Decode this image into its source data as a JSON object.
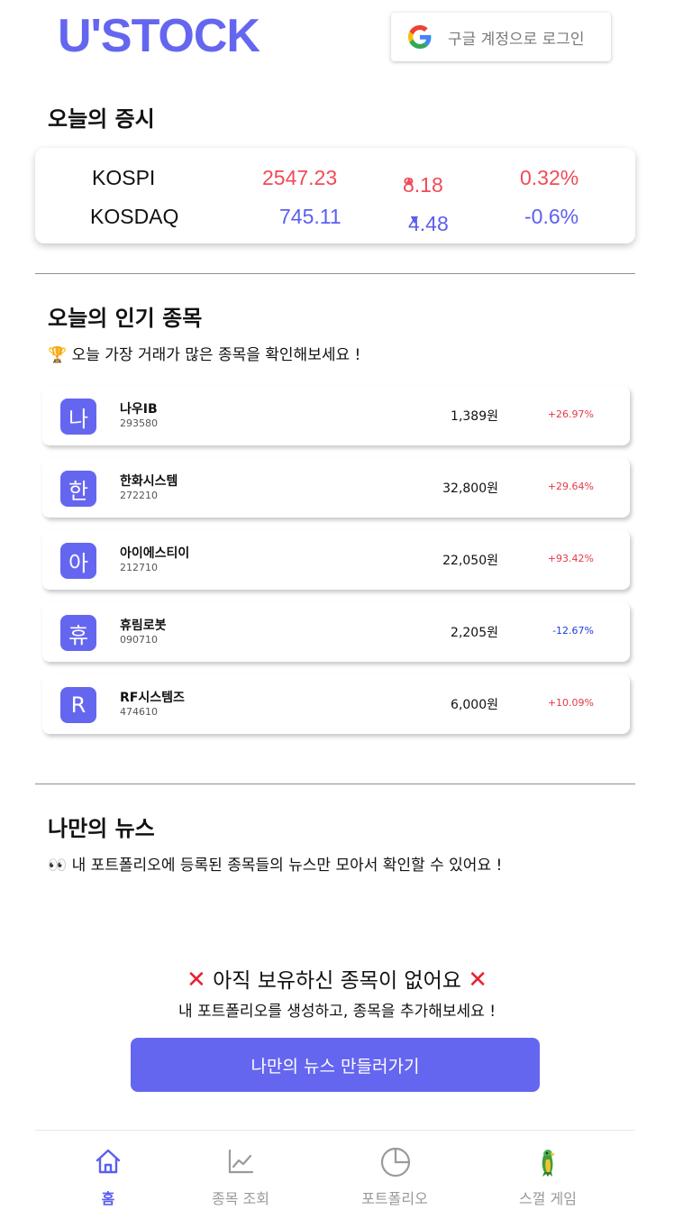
{
  "header": {
    "logo": "U'STOCK",
    "login_label": "구글 계정으로 로그인"
  },
  "market": {
    "title": "오늘의 증시",
    "indices": [
      {
        "name": "KOSPI",
        "value": "2547.23",
        "change": "8.18",
        "rate": "0.32%",
        "direction": "up"
      },
      {
        "name": "KOSDAQ",
        "value": "745.11",
        "change": "4.48",
        "rate": "-0.6%",
        "direction": "down"
      }
    ]
  },
  "popular": {
    "title": "오늘의 인기 종목",
    "subtitle": "오늘 가장 거래가 많은 종목을 확인해보세요 !",
    "subtitle_icon": "trophy-icon",
    "stocks": [
      {
        "avatar": "나",
        "name": "나우IB",
        "code": "293580",
        "price": "1,389원",
        "change": "+26.97%",
        "direction": "up"
      },
      {
        "avatar": "한",
        "name": "한화시스템",
        "code": "272210",
        "price": "32,800원",
        "change": "+29.64%",
        "direction": "up"
      },
      {
        "avatar": "아",
        "name": "아이에스티이",
        "code": "212710",
        "price": "22,050원",
        "change": "+93.42%",
        "direction": "up"
      },
      {
        "avatar": "휴",
        "name": "휴림로봇",
        "code": "090710",
        "price": "2,205원",
        "change": "-12.67%",
        "direction": "down"
      },
      {
        "avatar": "R",
        "name": "RF시스템즈",
        "code": "474610",
        "price": "6,000원",
        "change": "+10.09%",
        "direction": "up"
      }
    ]
  },
  "news": {
    "title": "나만의 뉴스",
    "subtitle": "내 포트폴리오에 등록된 종목들의 뉴스만 모아서 확인할 수 있어요 !",
    "subtitle_icon": "eyes-icon",
    "empty_title": "아직 보유하신 종목이 없어요",
    "empty_subtitle": "내 포트폴리오를 생성하고, 종목을 추가해보세요 !",
    "cta_label": "나만의 뉴스 만들러가기"
  },
  "nav": {
    "items": [
      {
        "label": "홈",
        "icon": "home-icon",
        "active": true
      },
      {
        "label": "종목 조회",
        "icon": "chart-line-icon",
        "active": false
      },
      {
        "label": "포트폴리오",
        "icon": "pie-chart-icon",
        "active": false
      },
      {
        "label": "스껄 게임",
        "icon": "parrot-icon",
        "active": false
      }
    ]
  },
  "colors": {
    "brand": "#6566f0",
    "up": "#f04b58",
    "down": "#5b5ff0"
  }
}
